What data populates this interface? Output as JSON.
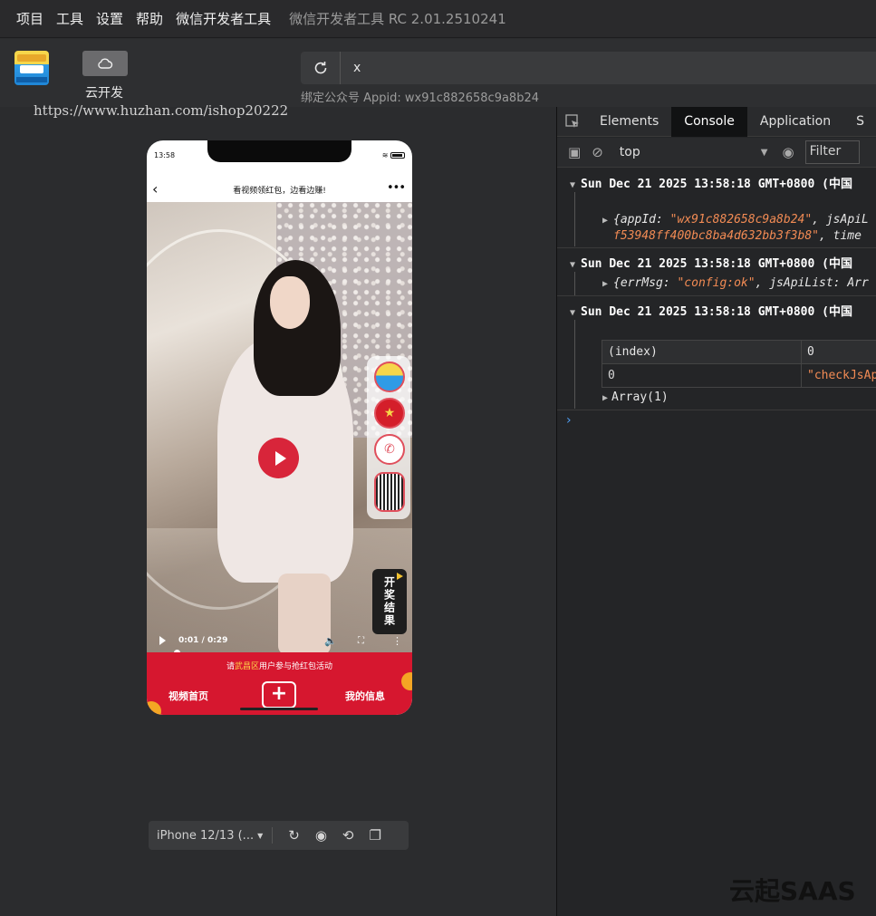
{
  "menu": {
    "items": [
      "项目",
      "工具",
      "设置",
      "帮助",
      "微信开发者工具"
    ],
    "app_title": "微信开发者工具 RC 2.01.2510241"
  },
  "toolbar": {
    "cloud_label": "云开发",
    "address_text": "x",
    "appid_text": "绑定公众号 Appid: wx91c882658c9a8b24"
  },
  "watermark_url": "https://www.huzhan.com/ishop20222",
  "phone": {
    "status_time": "13:58",
    "nav_title": "看视频领红包，边看边赚!",
    "video_time": "0:01 / 0:29",
    "prize_label": "开奖结果",
    "notice_prefix": "请",
    "notice_highlight": "武昌区",
    "notice_suffix": "用户参与抢红包活动",
    "tab_home": "视频首页",
    "tab_mine": "我的信息",
    "add_symbol": "+"
  },
  "device_bar": {
    "device": "iPhone 12/13 (..."
  },
  "devtools": {
    "tabs": [
      "Elements",
      "Console",
      "Application",
      "S"
    ],
    "active_tab": "Console",
    "context": "top",
    "filter_placeholder": "Filter",
    "logs": [
      {
        "timestamp": "Sun Dec 21 2025 13:58:18 GMT+0800 (中国",
        "line1_key": "{appId: ",
        "line1_val": "\"wx91c882658c9a8b24\"",
        "line1_rest": ", jsApiL",
        "line2_val": "f53948ff400bc8ba4d632bb3f3b8\"",
        "line2_rest": ", time"
      },
      {
        "timestamp": "Sun Dec 21 2025 13:58:18 GMT+0800 (中国",
        "line1_key": "{errMsg: ",
        "line1_val": "\"config:ok\"",
        "line1_rest": ", jsApiList: Arr"
      },
      {
        "timestamp": "Sun Dec 21 2025 13:58:18 GMT+0800 (中国"
      }
    ],
    "table": {
      "headers": [
        "(index)",
        "0"
      ],
      "rows": [
        [
          "0",
          "\"checkJsAp"
        ]
      ]
    },
    "array_label": "Array(1)"
  },
  "brand": "云起SAAS"
}
